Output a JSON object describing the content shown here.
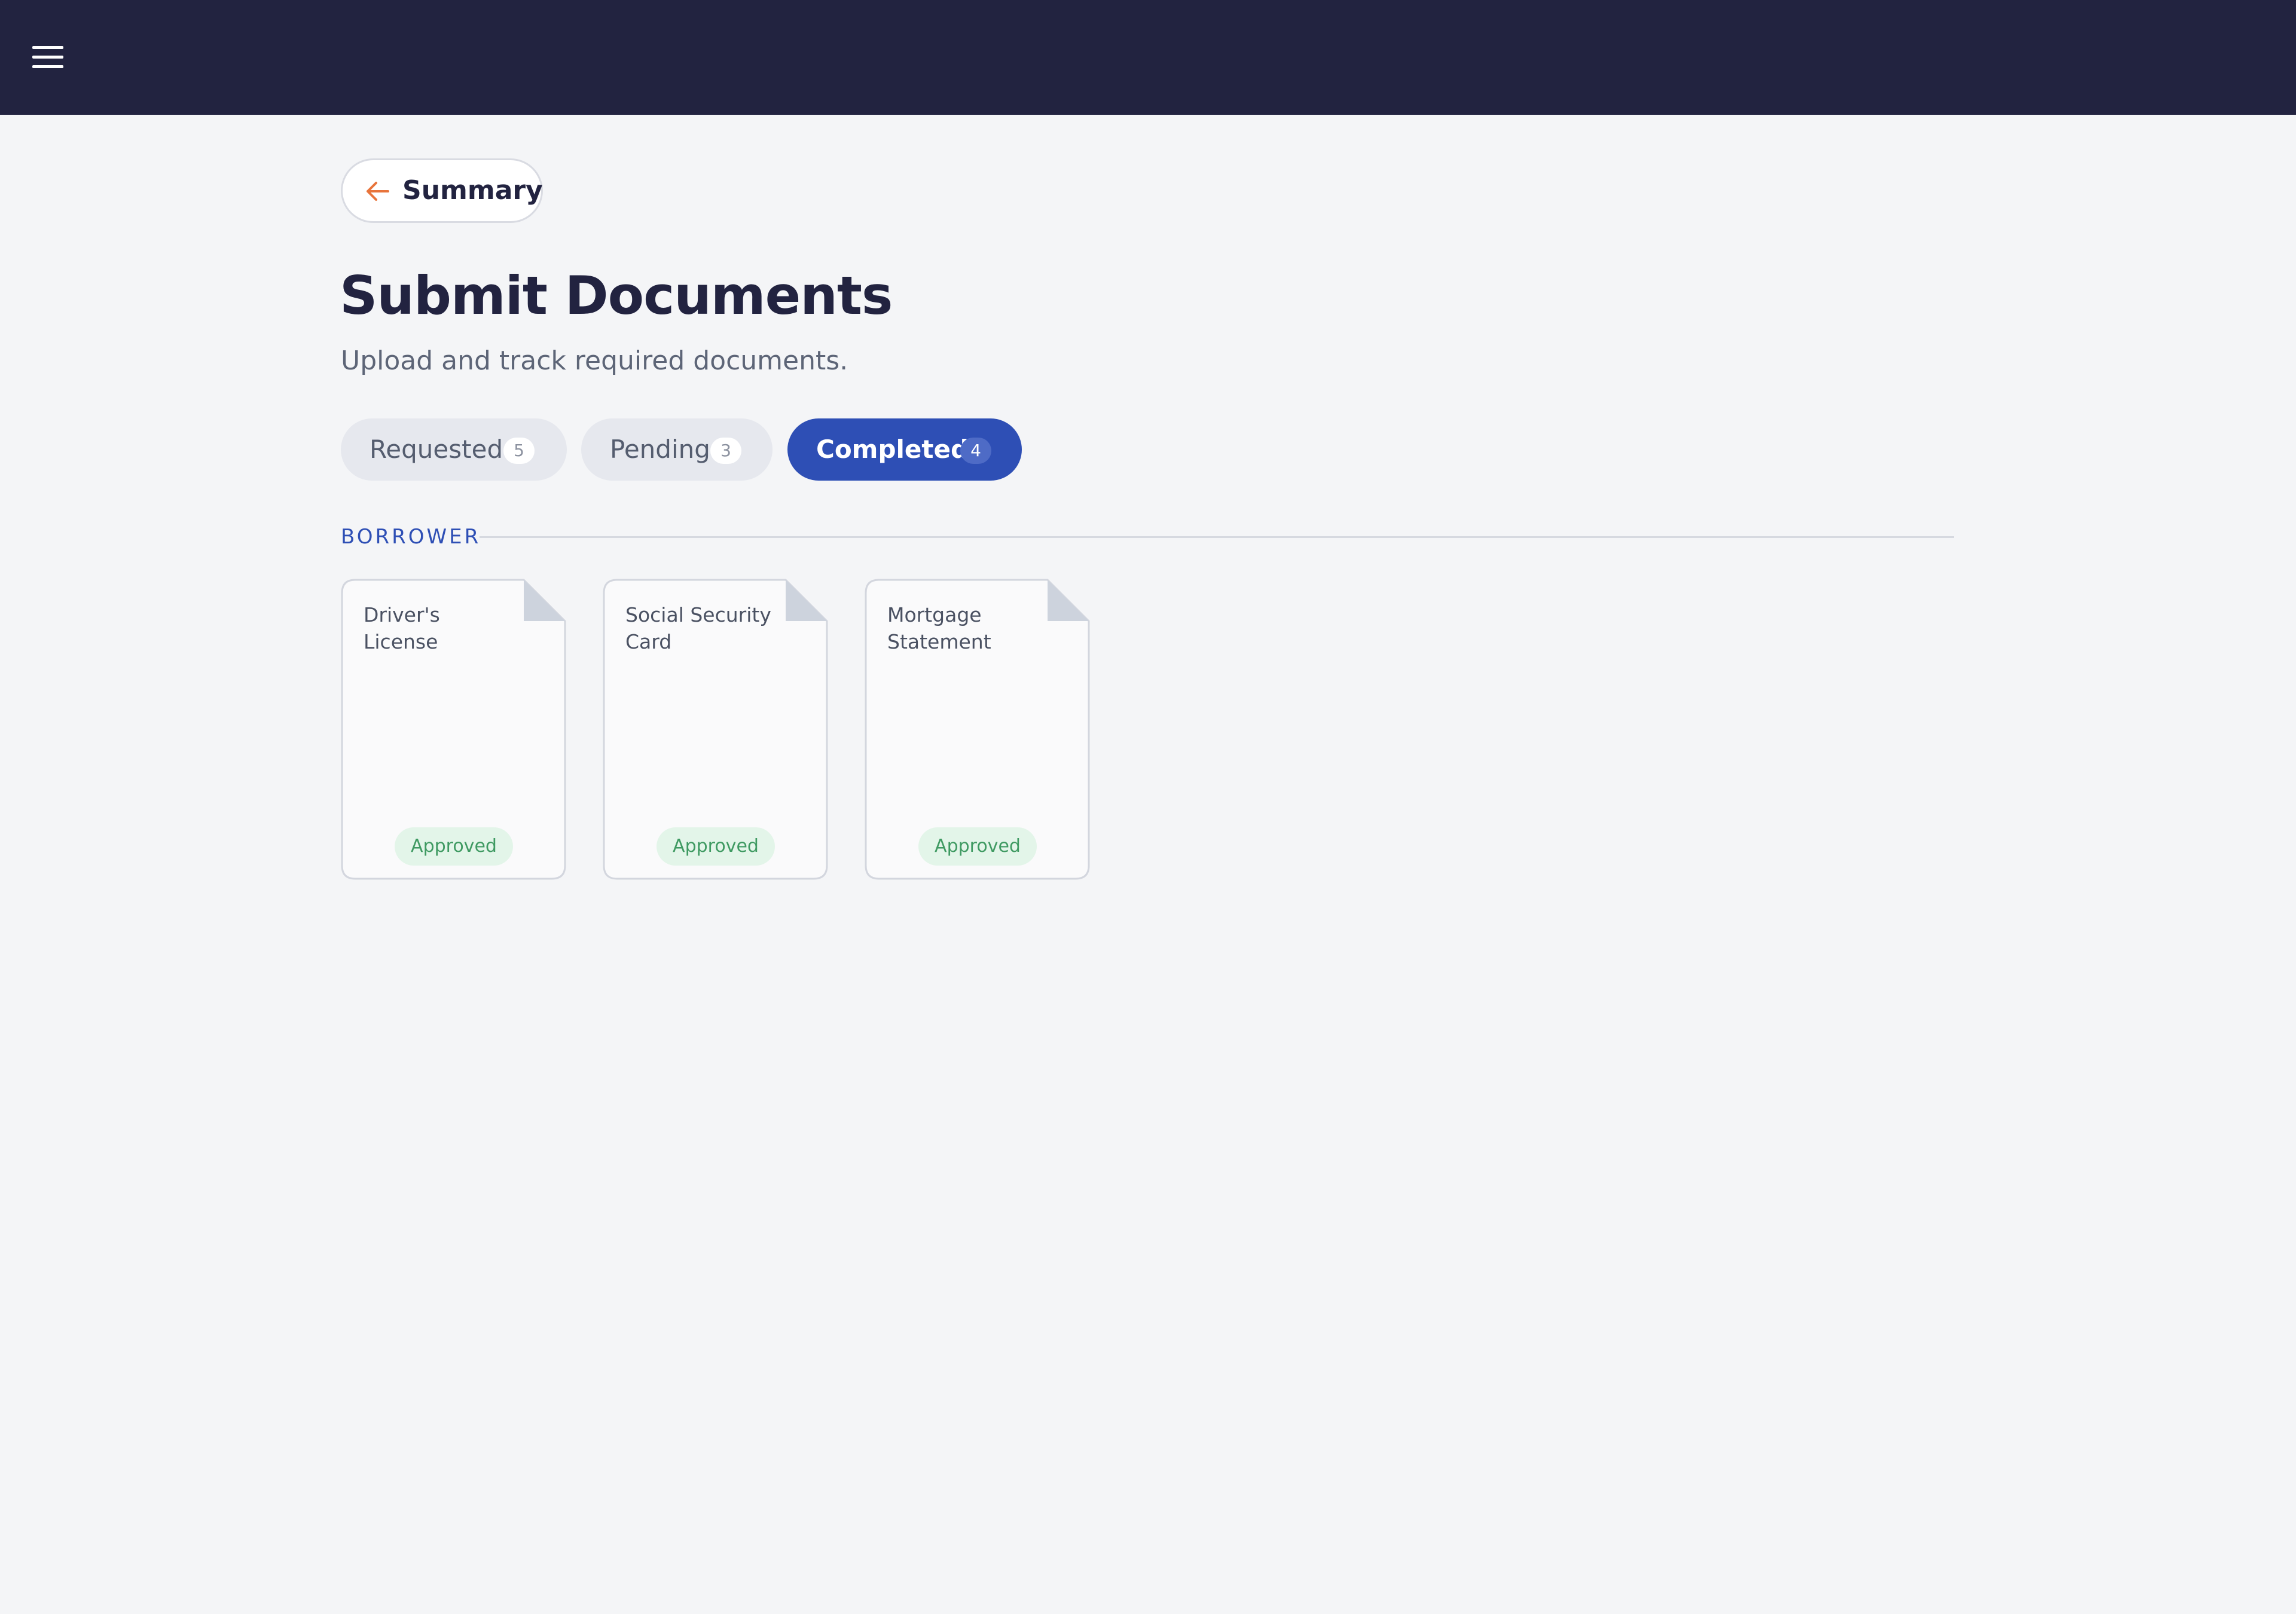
{
  "back_button": {
    "label": "Summary",
    "icon": "arrow-left-icon",
    "icon_color": "#e8743b"
  },
  "page": {
    "title": "Submit Documents",
    "subtitle": "Upload and track required documents."
  },
  "tabs": [
    {
      "label": "Requested",
      "count": "5",
      "active": false
    },
    {
      "label": "Pending",
      "count": "3",
      "active": false
    },
    {
      "label": "Completed",
      "count": "4",
      "active": true
    }
  ],
  "section": {
    "label": "BORROWER"
  },
  "documents": [
    {
      "title": "Driver's License",
      "status": "Approved"
    },
    {
      "title": "Social Security Card",
      "status": "Approved"
    },
    {
      "title": "Mortgage Statement",
      "status": "Approved"
    }
  ],
  "colors": {
    "header_bg": "#222340",
    "accent": "#2e4fb5",
    "approved_bg": "#e3f5e9",
    "approved_text": "#3f9a62"
  }
}
